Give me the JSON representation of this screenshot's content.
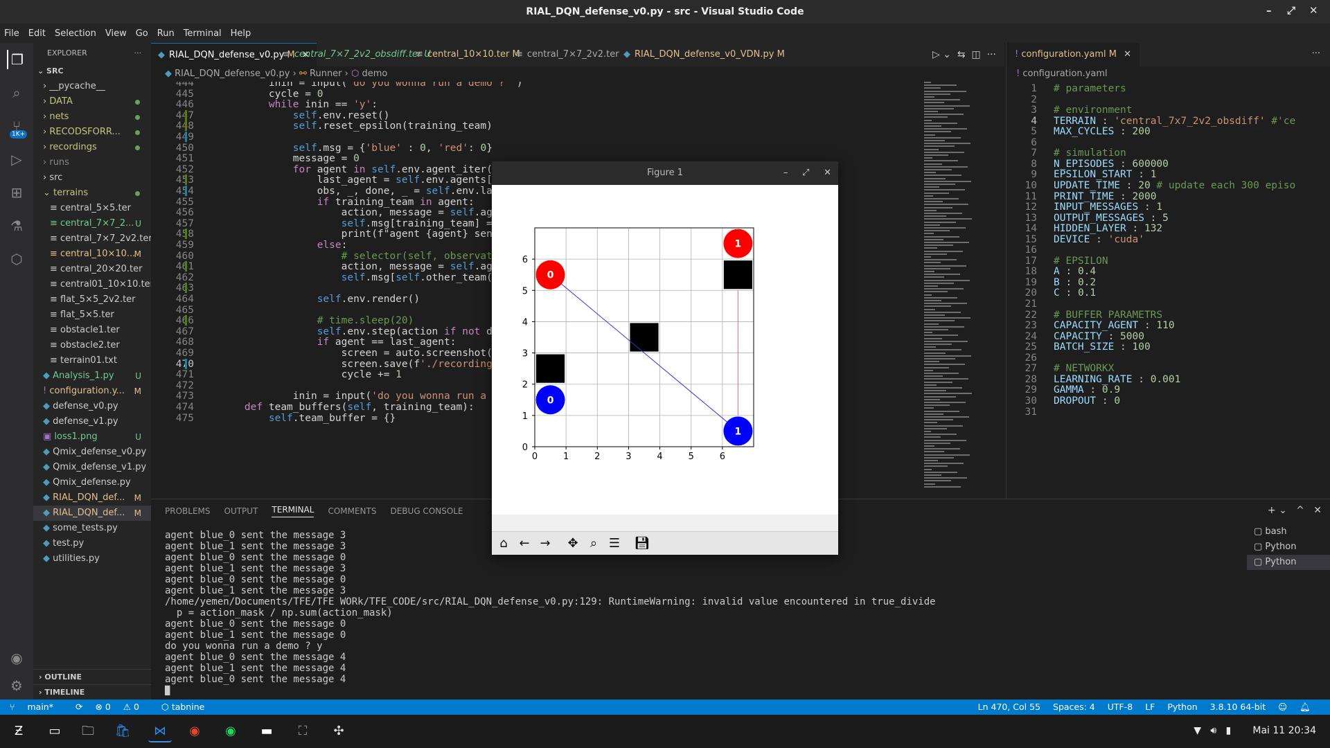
{
  "window": {
    "title": "RIAL_DQN_defense_v0.py - src - Visual Studio Code"
  },
  "menu": [
    "File",
    "Edit",
    "Selection",
    "View",
    "Go",
    "Run",
    "Terminal",
    "Help"
  ],
  "explorer": {
    "header": "EXPLORER",
    "root": "SRC",
    "items": [
      {
        "label": "__pycache__",
        "status": ""
      },
      {
        "label": "DATA",
        "status": "dot"
      },
      {
        "label": "nets",
        "status": "dot"
      },
      {
        "label": "RECODSFORR...",
        "status": "dot"
      },
      {
        "label": "recordings",
        "status": "dot"
      },
      {
        "label": "runs",
        "status": ""
      },
      {
        "label": "src",
        "status": ""
      },
      {
        "label": "terrains",
        "status": "dot"
      },
      {
        "label": "central_5×5.ter",
        "status": ""
      },
      {
        "label": "central_7×7_2...",
        "status": "U"
      },
      {
        "label": "central_7×7_2v2.ter",
        "status": ""
      },
      {
        "label": "central_10×10...",
        "status": "M"
      },
      {
        "label": "central_20×20.ter",
        "status": ""
      },
      {
        "label": "central01_10×10.ter",
        "status": ""
      },
      {
        "label": "flat_5×5_2v2.ter",
        "status": ""
      },
      {
        "label": "flat_5×5.ter",
        "status": ""
      },
      {
        "label": "obstacle1.ter",
        "status": ""
      },
      {
        "label": "obstacle2.ter",
        "status": ""
      },
      {
        "label": "terrain01.txt",
        "status": ""
      },
      {
        "label": "Analysis_1.py",
        "status": "U"
      },
      {
        "label": "configuration.y...",
        "status": "M"
      },
      {
        "label": "defense_v0.py",
        "status": ""
      },
      {
        "label": "defense_v1.py",
        "status": ""
      },
      {
        "label": "loss1.png",
        "status": "U"
      },
      {
        "label": "Qmix_defense_v0.py",
        "status": ""
      },
      {
        "label": "Qmix_defense_v1.py",
        "status": ""
      },
      {
        "label": "Qmix_defense.py",
        "status": ""
      },
      {
        "label": "RIAL_DQN_def...",
        "status": "M"
      },
      {
        "label": "RIAL_DQN_def...",
        "status": "M"
      },
      {
        "label": "some_tests.py",
        "status": ""
      },
      {
        "label": "test.py",
        "status": ""
      },
      {
        "label": "utilities.py",
        "status": ""
      }
    ],
    "outline": "OUTLINE",
    "timeline": "TIMELINE"
  },
  "tabs": [
    {
      "label": "RIAL_DQN_defense_v0.py",
      "status": "M"
    },
    {
      "label": "central_7×7_2v2_obsdiff.ter",
      "status": "U"
    },
    {
      "label": "central_10×10.ter",
      "status": "M"
    },
    {
      "label": "central_7×7_2v2.ter",
      "status": ""
    },
    {
      "label": "RIAL_DQN_defense_v0_VDN.py",
      "status": "M"
    }
  ],
  "breadcrumb": {
    "file": "RIAL_DQN_defense_v0.py",
    "cls": "Runner",
    "method": "demo"
  },
  "code": [
    {
      "n": "444",
      "t": "        inin = input('do you wonna run a demo ? ')"
    },
    {
      "n": "445",
      "t": "        cycle = 0"
    },
    {
      "n": "446",
      "t": "        while inin == 'y':"
    },
    {
      "n": "447",
      "t": "            self.env.reset()"
    },
    {
      "n": "448",
      "t": "            self.reset_epsilon(training_team)"
    },
    {
      "n": "449",
      "t": ""
    },
    {
      "n": "450",
      "t": "            self.msg = {'blue' : 0, 'red': 0}"
    },
    {
      "n": "451",
      "t": "            message = 0"
    },
    {
      "n": "452",
      "t": "            for agent in self.env.agent_iter():"
    },
    {
      "n": "453",
      "t": "                last_agent = self.env.agents[0]"
    },
    {
      "n": "454",
      "t": "                obs, _, done, _ = self.env.last()"
    },
    {
      "n": "455",
      "t": "                if training_team in agent:"
    },
    {
      "n": "456",
      "t": "                    action, message = self.agents[a"
    },
    {
      "n": "457",
      "t": "                    self.msg[training_team] = messa"
    },
    {
      "n": "458",
      "t": "                    print(f\"agent {agent} sent the"
    },
    {
      "n": "459",
      "t": "                else:"
    },
    {
      "n": "460",
      "t": "                    # selector(self, observation, d"
    },
    {
      "n": "461",
      "t": "                    action, message = self.agents[a                                       _team)])"
    },
    {
      "n": "462",
      "t": "                    self.msg[self.other_team(train"
    },
    {
      "n": "463",
      "t": ""
    },
    {
      "n": "464",
      "t": "                self.env.render()"
    },
    {
      "n": "465",
      "t": ""
    },
    {
      "n": "466",
      "t": "                # time.sleep(20)"
    },
    {
      "n": "467",
      "t": "                self.env.step(action if not done e"
    },
    {
      "n": "468",
      "t": "                if agent == last_agent:"
    },
    {
      "n": "469",
      "t": "                    screen = auto.screenshot()"
    },
    {
      "n": "470",
      "t": "                    screen.save(f'./recordings/Ter"
    },
    {
      "n": "471",
      "t": "                    cycle += 1"
    },
    {
      "n": "472",
      "t": ""
    },
    {
      "n": "473",
      "t": "            inin = input('do you wonna run a demo "
    },
    {
      "n": "474",
      "t": "    def team_buffers(self, training_team):"
    },
    {
      "n": "475",
      "t": "        self.team_buffer = {}"
    }
  ],
  "right_editor": {
    "tab": "configuration.yaml",
    "tab_status": "M",
    "crumb": "configuration.yaml",
    "lines": [
      {
        "n": "1",
        "t": "# parameters"
      },
      {
        "n": "2",
        "t": ""
      },
      {
        "n": "3",
        "t": "# environment"
      },
      {
        "n": "4",
        "t": "TERRAIN : 'central_7x7_2v2_obsdiff' #'ce"
      },
      {
        "n": "5",
        "t": "MAX_CYCLES : 200"
      },
      {
        "n": "6",
        "t": ""
      },
      {
        "n": "7",
        "t": "# simulation"
      },
      {
        "n": "8",
        "t": "N_EPISODES : 600000"
      },
      {
        "n": "9",
        "t": "EPSILON_START : 1"
      },
      {
        "n": "10",
        "t": "UPDATE_TIME : 20 # update each 300 episo"
      },
      {
        "n": "11",
        "t": "PRINT_TIME : 2000"
      },
      {
        "n": "12",
        "t": "INPUT_MESSAGES : 1"
      },
      {
        "n": "13",
        "t": "OUTPUT_MESSAGES : 5"
      },
      {
        "n": "14",
        "t": "HIDDEN_LAYER : 132"
      },
      {
        "n": "15",
        "t": "DEVICE : 'cuda'"
      },
      {
        "n": "16",
        "t": ""
      },
      {
        "n": "17",
        "t": "# EPSILON"
      },
      {
        "n": "18",
        "t": "A : 0.4"
      },
      {
        "n": "19",
        "t": "B : 0.2"
      },
      {
        "n": "20",
        "t": "C : 0.1"
      },
      {
        "n": "21",
        "t": ""
      },
      {
        "n": "22",
        "t": "# BUFFER PARAMETRS"
      },
      {
        "n": "23",
        "t": "CAPACITY_AGENT : 110"
      },
      {
        "n": "24",
        "t": "CAPACITY : 5000"
      },
      {
        "n": "25",
        "t": "BATCH_SIZE : 100"
      },
      {
        "n": "26",
        "t": ""
      },
      {
        "n": "27",
        "t": "# NETWORKX"
      },
      {
        "n": "28",
        "t": "LEARNING_RATE : 0.001"
      },
      {
        "n": "29",
        "t": "GAMMA : 0.9"
      },
      {
        "n": "30",
        "t": "DROPOUT : 0"
      },
      {
        "n": "31",
        "t": ""
      }
    ]
  },
  "panel": {
    "tabs": [
      "PROBLEMS",
      "OUTPUT",
      "TERMINAL",
      "COMMENTS",
      "DEBUG CONSOLE"
    ],
    "active": "TERMINAL",
    "terminal": [
      "agent blue_0 sent the message 3",
      "agent blue_1 sent the message 3",
      "agent blue_0 sent the message 0",
      "agent blue_1 sent the message 3",
      "agent blue_0 sent the message 0",
      "agent blue_1 sent the message 3",
      "/home/yemen/Documents/TFE/TFE WORk/TFE_CODE/src/RIAL_DQN_defense_v0.py:129: RuntimeWarning: invalid value encountered in true_divide",
      "  p = action_mask / np.sum(action_mask)",
      "agent blue_0 sent the message 0",
      "agent blue_1 sent the message 0",
      "do you wonna run a demo ? y",
      "agent blue_0 sent the message 4",
      "agent blue_1 sent the message 4",
      "agent blue_0 sent the message 4"
    ],
    "terminals": [
      "bash",
      "Python",
      "Python"
    ]
  },
  "figure": {
    "title": "Figure 1",
    "x_ticks": [
      "0",
      "1",
      "2",
      "3",
      "4",
      "5",
      "6"
    ],
    "y_ticks": [
      "0",
      "1",
      "2",
      "3",
      "4",
      "5",
      "6"
    ],
    "agents": [
      {
        "label": "0",
        "team": "red",
        "x": 0.5,
        "y": 5.5,
        "color": "#ff0000"
      },
      {
        "label": "1",
        "team": "red",
        "x": 6.5,
        "y": 6.5,
        "color": "#ff0000"
      },
      {
        "label": "0",
        "team": "blue",
        "x": 0.5,
        "y": 1.5,
        "color": "#0000ff"
      },
      {
        "label": "1",
        "team": "blue",
        "x": 6.5,
        "y": 0.5,
        "color": "#0000ff"
      }
    ],
    "obstacles": [
      [
        0,
        2
      ],
      [
        3,
        3
      ],
      [
        6,
        5
      ]
    ],
    "lines": [
      {
        "from": [
          0.5,
          5.5
        ],
        "to": [
          6.5,
          0.5
        ],
        "color": "#3333cc"
      },
      {
        "from": [
          6.5,
          5
        ],
        "to": [
          6.5,
          1
        ],
        "color": "#ff6666"
      }
    ]
  },
  "status": {
    "branch": "main*",
    "errors": "0",
    "warnings": "0",
    "tabnine": "tabnine",
    "position": "Ln 470, Col 55",
    "spaces": "Spaces: 4",
    "encoding": "UTF-8",
    "eol": "LF",
    "lang": "Python",
    "interpreter": "3.8.10 64-bit"
  },
  "taskbar": {
    "clock": "Mai 11  20:34"
  }
}
